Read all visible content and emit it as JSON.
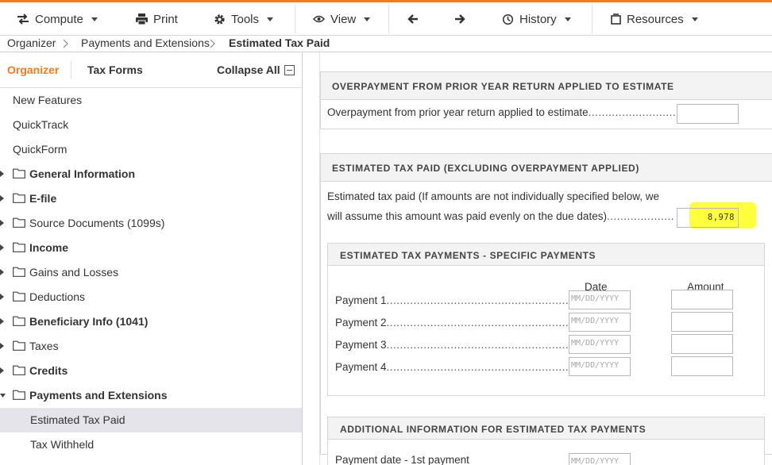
{
  "toolbar": {
    "compute": "Compute",
    "print": "Print",
    "tools": "Tools",
    "view": "View",
    "history": "History",
    "resources": "Resources",
    "accent_color": "#f47b20"
  },
  "breadcrumb": [
    "Organizer",
    "Payments and Extensions",
    "Estimated Tax Paid"
  ],
  "sidebar": {
    "tabs": {
      "organizer": "Organizer",
      "tax_forms": "Tax Forms"
    },
    "collapse_all": "Collapse All",
    "items": [
      {
        "label": "New Features",
        "folder": false,
        "bold": false,
        "arrow": "none"
      },
      {
        "label": "QuickTrack",
        "folder": false,
        "bold": false,
        "arrow": "none"
      },
      {
        "label": "QuickForm",
        "folder": false,
        "bold": false,
        "arrow": "none"
      },
      {
        "label": "General Information",
        "folder": true,
        "bold": true,
        "arrow": "right"
      },
      {
        "label": "E-file",
        "folder": true,
        "bold": true,
        "arrow": "right"
      },
      {
        "label": "Source Documents (1099s)",
        "folder": true,
        "bold": false,
        "arrow": "right"
      },
      {
        "label": "Income",
        "folder": true,
        "bold": true,
        "arrow": "right"
      },
      {
        "label": "Gains and Losses",
        "folder": true,
        "bold": false,
        "arrow": "right"
      },
      {
        "label": "Deductions",
        "folder": true,
        "bold": false,
        "arrow": "right"
      },
      {
        "label": "Beneficiary Info (1041)",
        "folder": true,
        "bold": true,
        "arrow": "right"
      },
      {
        "label": "Taxes",
        "folder": true,
        "bold": false,
        "arrow": "right"
      },
      {
        "label": "Credits",
        "folder": true,
        "bold": true,
        "arrow": "right"
      },
      {
        "label": "Payments and Extensions",
        "folder": true,
        "bold": true,
        "arrow": "down"
      },
      {
        "label": "Estimated Tax Paid",
        "folder": false,
        "bold": false,
        "arrow": "none",
        "child": true,
        "selected": true
      },
      {
        "label": "Tax Withheld",
        "folder": false,
        "bold": false,
        "arrow": "none",
        "child": true
      }
    ]
  },
  "main": {
    "overpayment": {
      "title": "OVERPAYMENT FROM PRIOR YEAR RETURN APPLIED TO ESTIMATE",
      "label": "Overpayment from prior year return applied to estimate",
      "value": ""
    },
    "estimated": {
      "title": "ESTIMATED TAX PAID (EXCLUDING OVERPAYMENT APPLIED)",
      "label_line1": "Estimated tax paid (If amounts are not individually specified below, we",
      "label_line2": "will assume this amount was paid evenly on the due dates)",
      "value": "8,978",
      "highlight_color": "#ffff3d"
    },
    "specific": {
      "title": "ESTIMATED TAX PAYMENTS - SPECIFIC PAYMENTS",
      "col_date": "Date",
      "col_amount": "Amount",
      "date_placeholder": "MM/DD/YYYY",
      "payments": [
        {
          "label": "Payment 1",
          "date": "",
          "amount": ""
        },
        {
          "label": "Payment 2",
          "date": "",
          "amount": ""
        },
        {
          "label": "Payment 3",
          "date": "",
          "amount": ""
        },
        {
          "label": "Payment 4",
          "date": "",
          "amount": ""
        }
      ]
    },
    "additional": {
      "title": "ADDITIONAL INFORMATION FOR ESTIMATED TAX PAYMENTS",
      "first_label": "Payment date - 1st payment",
      "date_placeholder": "MM/DD/YYYY"
    }
  }
}
